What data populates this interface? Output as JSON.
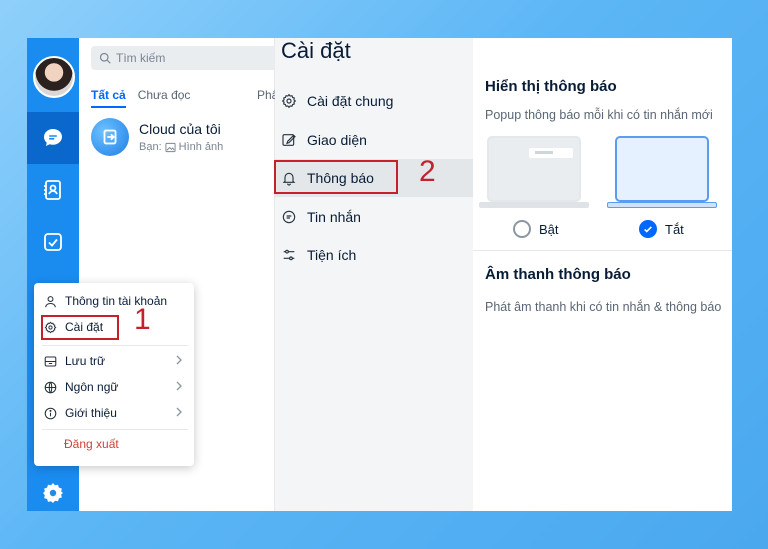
{
  "search": {
    "placeholder": "Tìm kiếm"
  },
  "tabs": [
    {
      "label": "Tất cả",
      "active": true
    },
    {
      "label": "Chưa đọc",
      "active": false
    }
  ],
  "tab_cut_label": "Phâ",
  "conversations": [
    {
      "title": "Cloud của tôi",
      "sub_prefix": "Bạn:",
      "sub_text": "Hình ảnh",
      "icon": "cloud-share-icon"
    }
  ],
  "settings": {
    "title": "Cài đặt",
    "items": [
      {
        "label": "Cài đặt chung",
        "icon": "gear-icon"
      },
      {
        "label": "Giao diện",
        "icon": "edit-icon"
      },
      {
        "label": "Thông báo",
        "icon": "bell-icon",
        "active": true
      },
      {
        "label": "Tin nhắn",
        "icon": "chat-icon"
      },
      {
        "label": "Tiện ích",
        "icon": "sliders-icon"
      }
    ]
  },
  "notifications": {
    "display_heading": "Hiển thị thông báo",
    "display_desc": "Popup thông báo mỗi khi có tin nhắn mới",
    "option_on": "Bật",
    "option_off": "Tắt",
    "selected": "off",
    "sound_heading": "Âm thanh thông báo",
    "sound_desc": "Phát âm thanh khi có tin nhắn & thông báo"
  },
  "popup_menu": {
    "items": [
      {
        "label": "Thông tin tài khoản",
        "icon": "user-icon"
      },
      {
        "label": "Cài đặt",
        "icon": "gear-icon"
      },
      {
        "label": "Lưu trữ",
        "icon": "storage-icon",
        "submenu": true
      },
      {
        "label": "Ngôn ngữ",
        "icon": "globe-icon",
        "submenu": true
      },
      {
        "label": "Giới thiệu",
        "icon": "info-icon",
        "submenu": true
      }
    ],
    "logout": "Đăng xuất"
  },
  "annotations": {
    "step1": "1",
    "step2": "2"
  },
  "colors": {
    "rail": "#1a8cf0",
    "rail_active": "#0a68cc",
    "accent": "#0068ff",
    "annotation": "#c4212b",
    "logout": "#d0403b"
  }
}
